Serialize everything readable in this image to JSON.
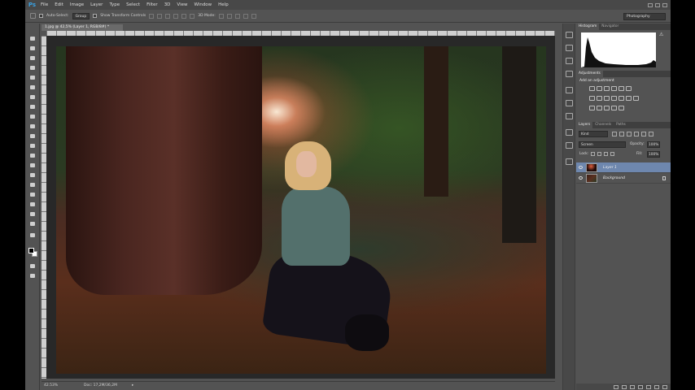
{
  "app": {
    "logo": "Ps",
    "menu": [
      "File",
      "Edit",
      "Image",
      "Layer",
      "Type",
      "Select",
      "Filter",
      "3D",
      "View",
      "Window",
      "Help"
    ]
  },
  "options": {
    "auto_select_label": "Auto-Select:",
    "auto_select_value": "Group",
    "transform_label": "Show Transform Controls",
    "mode_3d_label": "3D Mode:",
    "workspace": "Photography"
  },
  "document": {
    "tab_title": "1.jpg @ 42,5% (Layer 1, RGB/8#) *"
  },
  "status": {
    "zoom": "42.53%",
    "doc": "Doc: 17,2M/36,2M",
    "arrow": "▸"
  },
  "panels": {
    "top_tabs": [
      "Histogram",
      "Navigator"
    ],
    "adjust_tabs": [
      "Adjustments"
    ],
    "adjust_label": "Add an adjustment",
    "layer_tabs": [
      "Layers",
      "Channels",
      "Paths"
    ],
    "kind": "Kind",
    "blend_mode": "Screen",
    "opacity_label": "Opacity:",
    "opacity_value": "100%",
    "lock_label": "Lock:",
    "fill_label": "Fill:",
    "fill_value": "100%"
  },
  "layers": [
    {
      "name": "Layer 1",
      "selected": true
    },
    {
      "name": "Background",
      "selected": false
    }
  ],
  "colors": {
    "accent": "#3aa0e0",
    "selection": "#6e87ae"
  }
}
